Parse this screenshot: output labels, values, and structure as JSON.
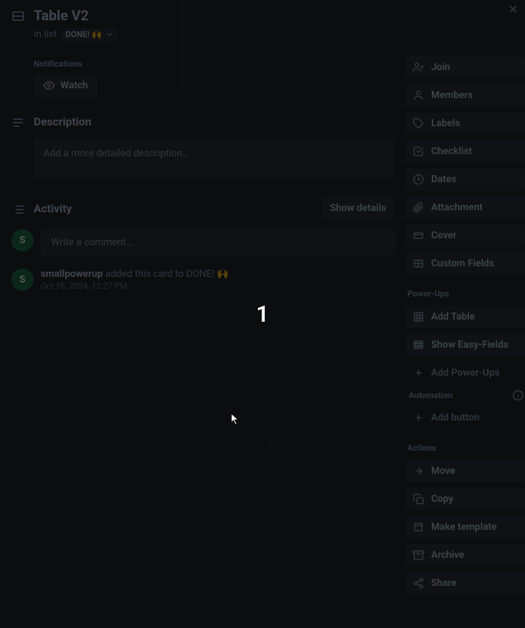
{
  "card": {
    "title": "Table V2",
    "in_list_prefix": "in list",
    "list_name": "DONE! 🙌"
  },
  "notifications": {
    "label": "Notifications",
    "watch_label": "Watch"
  },
  "description": {
    "title": "Description",
    "placeholder": "Add a more detailed description…"
  },
  "activity": {
    "title": "Activity",
    "show_details": "Show details",
    "comment_placeholder": "Write a comment…",
    "entries": [
      {
        "avatar_initial": "S",
        "user": "smallpowerup",
        "action": "added this card to DONE! 🙌",
        "timestamp": "Oct 18, 2024, 12:27 PM"
      }
    ],
    "compose_avatar_initial": "S"
  },
  "sidebar": {
    "add_to_card": [
      {
        "icon": "user-plus",
        "label": "Join"
      },
      {
        "icon": "user",
        "label": "Members"
      },
      {
        "icon": "tag",
        "label": "Labels"
      },
      {
        "icon": "check-square",
        "label": "Checklist"
      },
      {
        "icon": "clock",
        "label": "Dates"
      },
      {
        "icon": "paperclip",
        "label": "Attachment"
      },
      {
        "icon": "card",
        "label": "Cover"
      },
      {
        "icon": "field",
        "label": "Custom Fields"
      }
    ],
    "powerups_heading": "Power-Ups",
    "powerups": [
      {
        "icon": "table",
        "label": "Add Table"
      },
      {
        "icon": "easy-fields",
        "label": "Show Easy-Fields"
      }
    ],
    "add_powerups": "Add Power-Ups",
    "automation_heading": "Automation",
    "add_button": "Add button",
    "actions_heading": "Actions",
    "actions": [
      {
        "icon": "arrow-right",
        "label": "Move"
      },
      {
        "icon": "copy",
        "label": "Copy"
      },
      {
        "icon": "template",
        "label": "Make template"
      },
      {
        "icon": "archive",
        "label": "Archive"
      },
      {
        "icon": "share",
        "label": "Share"
      }
    ]
  },
  "overlay_number": "1"
}
